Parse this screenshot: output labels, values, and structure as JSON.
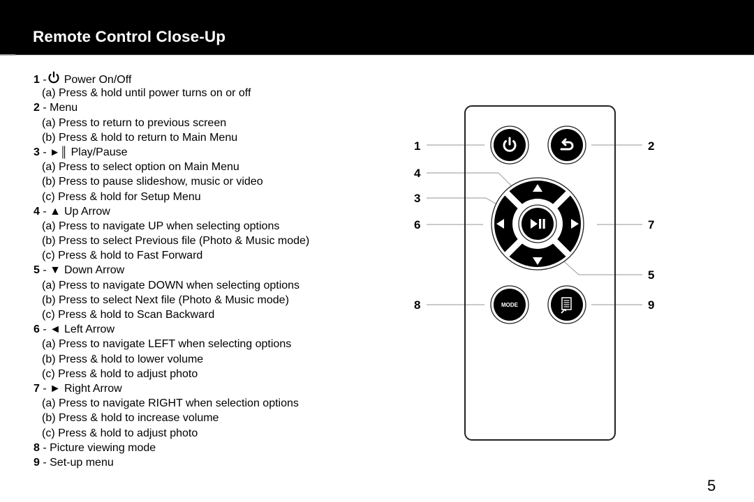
{
  "header": {
    "title": "Remote Control Close-Up"
  },
  "instructions": [
    {
      "num": "1",
      "sep": " -",
      "icon": "power-icon",
      "label": "Power On/Off",
      "subs": [
        "(a) Press & hold until power turns on or off"
      ]
    },
    {
      "num": "2",
      "sep": " - ",
      "icon": "",
      "label": "Menu",
      "subs": [
        "(a) Press to return to previous screen",
        "(b) Press & hold to return to Main Menu"
      ]
    },
    {
      "num": "3",
      "sep": " - ",
      "icon": "play-pause-icon",
      "glyph": "►║",
      "label": "Play/Pause",
      "subs": [
        "(a) Press to select option on Main Menu",
        "(b) Press to pause slideshow, music or video",
        "(c) Press & hold for Setup Menu"
      ]
    },
    {
      "num": "4",
      "sep": " - ",
      "icon": "up-arrow-icon",
      "glyph": "▲",
      "label": "Up Arrow",
      "subs": [
        "(a) Press to navigate UP when selecting options",
        "(b) Press to select Previous file (Photo & Music mode)",
        "(c) Press & hold to Fast Forward"
      ]
    },
    {
      "num": "5",
      "sep": " - ",
      "icon": "down-arrow-icon",
      "glyph": "▼",
      "label": "Down Arrow",
      "subs": [
        "(a) Press to navigate DOWN when selecting options",
        "(b) Press to select Next file (Photo & Music mode)",
        "(c) Press & hold to Scan Backward"
      ]
    },
    {
      "num": "6",
      "sep": " - ",
      "icon": "left-arrow-icon",
      "glyph": "◄",
      "label": "Left Arrow",
      "subs": [
        "(a) Press to navigate LEFT when selecting options",
        "(b) Press & hold to lower volume",
        "(c) Press & hold to adjust photo"
      ]
    },
    {
      "num": "7",
      "sep": " - ",
      "icon": "right-arrow-icon",
      "glyph": "►",
      "label": "Right Arrow",
      "subs": [
        "(a) Press to navigate RIGHT when selection options",
        "(b) Press & hold to increase volume",
        "(c) Press & hold to adjust photo"
      ]
    },
    {
      "num": "8",
      "sep": " - ",
      "icon": "",
      "label": "Picture viewing mode",
      "subs": []
    },
    {
      "num": "9",
      "sep": " - ",
      "icon": "",
      "label": "Set-up menu",
      "subs": []
    }
  ],
  "remote": {
    "callouts": {
      "c1": "1",
      "c2": "2",
      "c3": "3",
      "c4": "4",
      "c5": "5",
      "c6": "6",
      "c7": "7",
      "c8": "8",
      "c9": "9"
    },
    "mode_label": "MODE"
  },
  "page_number": "5"
}
